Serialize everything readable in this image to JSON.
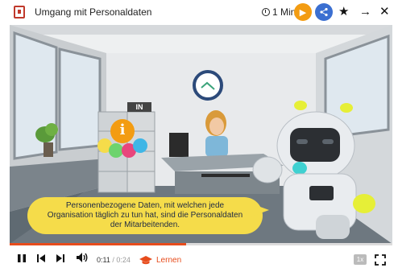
{
  "header": {
    "title": "Umgang mit Personaldaten",
    "duration": "1 Min.",
    "icons": [
      "document-icon",
      "clock-icon",
      "play-circle-icon",
      "share-icon",
      "star-icon",
      "next-arrow-icon",
      "close-icon"
    ],
    "accent_orange": "#f39c12",
    "accent_blue": "#3b6fd1"
  },
  "video": {
    "sign_text": "IN",
    "info_glyph": "i",
    "caption_lines": [
      "Personenbezogene Daten, mit welchen jede",
      "Organisation täglich zu tun hat, sind die Personaldaten",
      "der Mitarbeitenden."
    ],
    "caption_color": "#f5dc4a"
  },
  "player": {
    "current_time": "0:11",
    "separator": " / ",
    "duration": "0:24",
    "progress": 0.46,
    "learn_label": "Lernen",
    "speed_label": "1x",
    "progress_color": "#e74c1c"
  }
}
